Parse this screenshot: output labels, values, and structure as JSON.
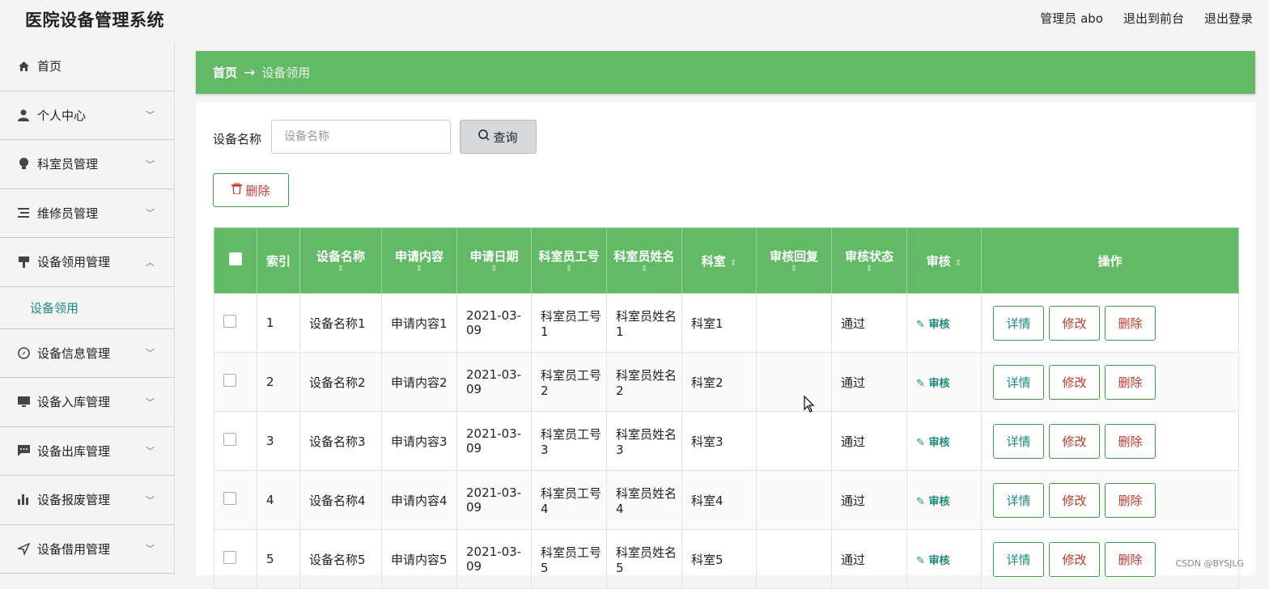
{
  "app": {
    "title": "医院设备管理系统"
  },
  "top_nav": {
    "user": "管理员 abo",
    "to_front": "退出到前台",
    "logout": "退出登录"
  },
  "sidebar": {
    "items": [
      {
        "label": "首页"
      },
      {
        "label": "个人中心"
      },
      {
        "label": "科室员管理"
      },
      {
        "label": "维修员管理"
      },
      {
        "label": "设备领用管理"
      },
      {
        "label": "设备信息管理"
      },
      {
        "label": "设备入库管理"
      },
      {
        "label": "设备出库管理"
      },
      {
        "label": "设备报废管理"
      },
      {
        "label": "设备借用管理"
      }
    ],
    "sub_item": "设备领用"
  },
  "breadcrumb": {
    "home": "首页",
    "arrow": "→",
    "current": "设备领用"
  },
  "search": {
    "label": "设备名称",
    "placeholder": "设备名称",
    "button": "查询"
  },
  "toolbar": {
    "delete_label": "删除"
  },
  "table": {
    "headers": [
      "索引",
      "设备名称",
      "申请内容",
      "申请日期",
      "科室员工号",
      "科室员姓名",
      "科室",
      "审核回复",
      "审核状态",
      "审核",
      "操作"
    ],
    "sort_glyph": "⇕",
    "audit_label": "审核",
    "action_labels": {
      "detail": "详情",
      "edit": "修改",
      "delete": "删除"
    },
    "rows": [
      {
        "index": "1",
        "name": "设备名称1",
        "content": "申请内容1",
        "date": "2021-03-09",
        "emp_no": "科室员工号1",
        "emp_name": "科室员姓名1",
        "dept": "科室1",
        "reply": "",
        "status": "通过"
      },
      {
        "index": "2",
        "name": "设备名称2",
        "content": "申请内容2",
        "date": "2021-03-09",
        "emp_no": "科室员工号2",
        "emp_name": "科室员姓名2",
        "dept": "科室2",
        "reply": "",
        "status": "通过"
      },
      {
        "index": "3",
        "name": "设备名称3",
        "content": "申请内容3",
        "date": "2021-03-09",
        "emp_no": "科室员工号3",
        "emp_name": "科室员姓名3",
        "dept": "科室3",
        "reply": "",
        "status": "通过"
      },
      {
        "index": "4",
        "name": "设备名称4",
        "content": "申请内容4",
        "date": "2021-03-09",
        "emp_no": "科室员工号4",
        "emp_name": "科室员姓名4",
        "dept": "科室4",
        "reply": "",
        "status": "通过"
      },
      {
        "index": "5",
        "name": "设备名称5",
        "content": "申请内容5",
        "date": "2021-03-09",
        "emp_no": "科室员工号5",
        "emp_name": "科室员姓名5",
        "dept": "科室5",
        "reply": "",
        "status": "通过"
      }
    ]
  },
  "watermark": "CSDN @BYSJLG",
  "colors": {
    "primary_green": "#62ba66",
    "accent_teal": "#1e8a7a",
    "danger_red": "#c0392b"
  },
  "icons": [
    "home-icon",
    "user-icon",
    "bulb-icon",
    "list-icon",
    "stamp-icon",
    "compass-icon",
    "monitor-icon",
    "chat-icon",
    "bar-chart-icon",
    "send-icon",
    "search-icon",
    "trash-icon",
    "edit-pen-icon",
    "chevron-down-icon",
    "chevron-up-icon"
  ]
}
